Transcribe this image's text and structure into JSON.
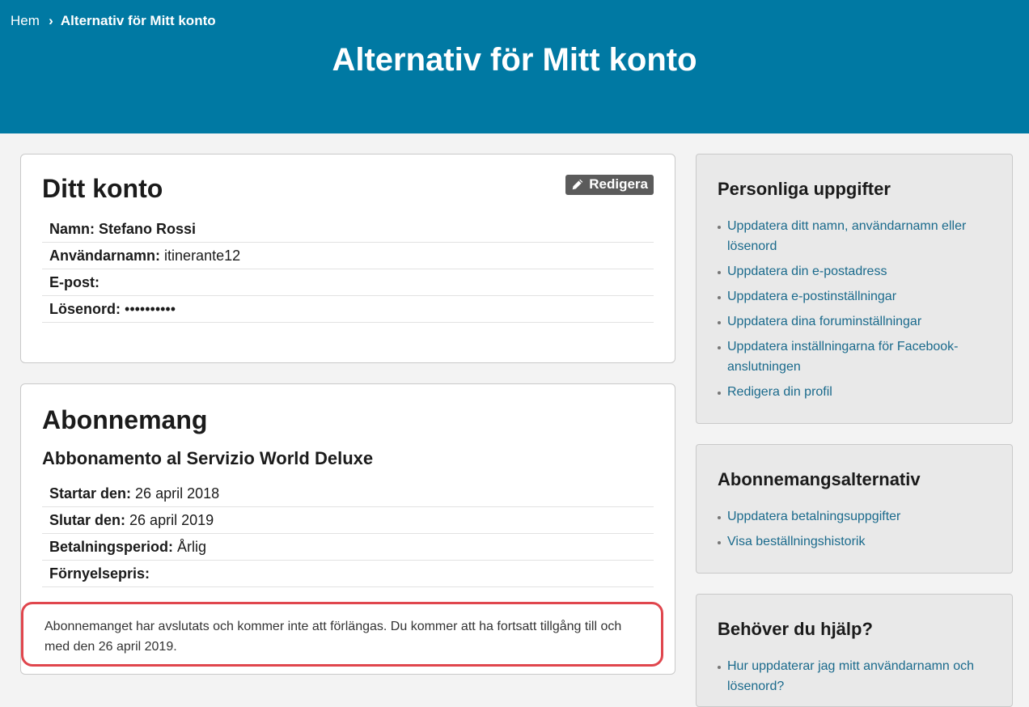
{
  "breadcrumb": {
    "home": "Hem",
    "current": "Alternativ för Mitt konto"
  },
  "page_title": "Alternativ för Mitt konto",
  "account": {
    "heading": "Ditt konto",
    "edit_label": "Redigera",
    "rows": [
      {
        "key": "Namn:",
        "value": "Stefano Rossi"
      },
      {
        "key": "Användarnamn:",
        "value": "itinerante12"
      },
      {
        "key": "E-post:",
        "value": ""
      },
      {
        "key": "Lösenord:",
        "value": "••••••••••"
      }
    ]
  },
  "subscription": {
    "heading": "Abonnemang",
    "plan": "Abbonamento al Servizio World Deluxe",
    "rows": [
      {
        "key": "Startar den:",
        "value": "26 april 2018"
      },
      {
        "key": "Slutar den:",
        "value": "26 april 2019"
      },
      {
        "key": "Betalningsperiod:",
        "value": "Årlig"
      },
      {
        "key": "Förnyelsepris:",
        "value": ""
      }
    ],
    "notice": "Abonnemanget har avslutats och kommer inte att förlängas. Du kommer att ha fortsatt tillgång till och med den 26 april 2019."
  },
  "sidebar": {
    "personal": {
      "heading": "Personliga uppgifter",
      "links": [
        "Uppdatera ditt namn, användarnamn eller lösenord",
        "Uppdatera din e-postadress",
        "Uppdatera e-postinställningar",
        "Uppdatera dina foruminställningar",
        "Uppdatera inställningarna för Facebook-anslutningen",
        "Redigera din profil"
      ]
    },
    "subscription_options": {
      "heading": "Abonnemangsalternativ",
      "links": [
        "Uppdatera betalningsuppgifter",
        "Visa beställningshistorik"
      ]
    },
    "help": {
      "heading": "Behöver du hjälp?",
      "links": [
        "Hur uppdaterar jag mitt användarnamn och lösenord?"
      ]
    }
  },
  "colors": {
    "header_bg": "#0079a3",
    "link": "#1a6a8c",
    "notice_border": "#e0464d"
  }
}
